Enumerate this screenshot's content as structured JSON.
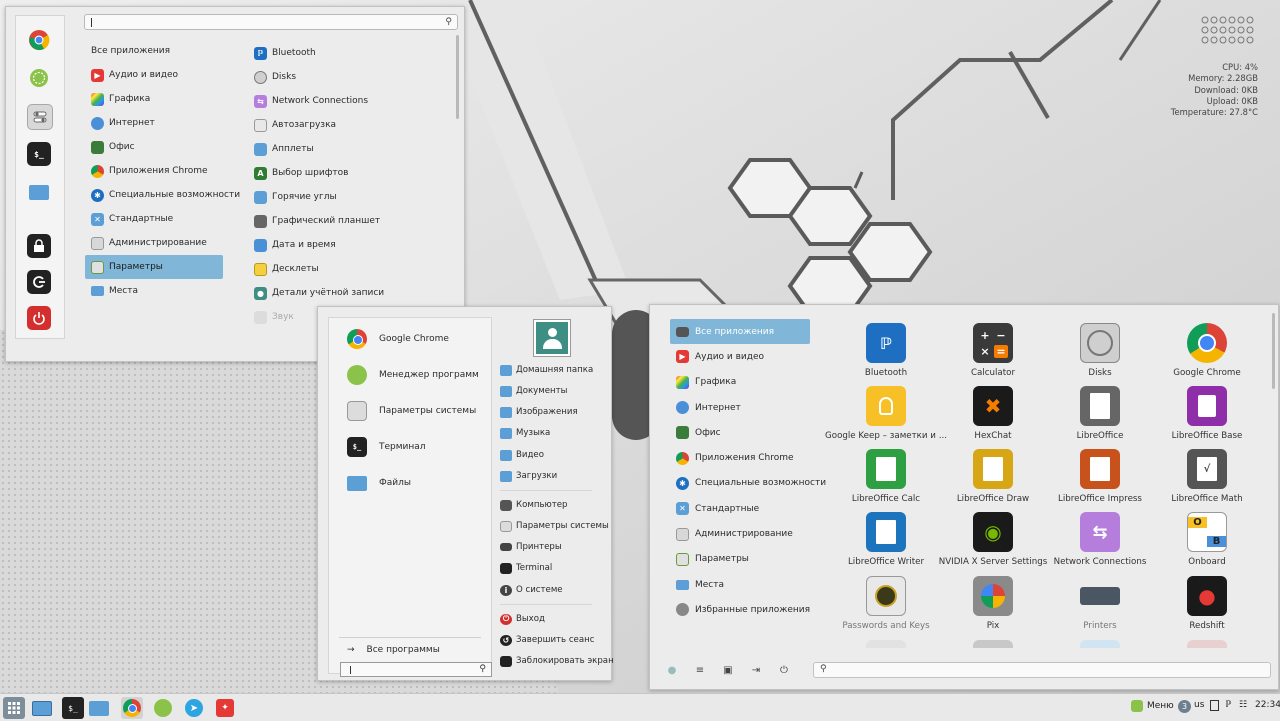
{
  "menu1": {
    "categories": [
      {
        "label": "Все приложения"
      },
      {
        "label": "Аудио и видео"
      },
      {
        "label": "Графика"
      },
      {
        "label": "Интернет"
      },
      {
        "label": "Офис"
      },
      {
        "label": "Приложения Chrome"
      },
      {
        "label": "Специальные возможности"
      },
      {
        "label": "Стандартные"
      },
      {
        "label": "Администрирование"
      },
      {
        "label": "Параметры"
      },
      {
        "label": "Места"
      }
    ],
    "apps": [
      {
        "label": "Bluetooth"
      },
      {
        "label": "Disks"
      },
      {
        "label": "Network Connections"
      },
      {
        "label": "Автозагрузка"
      },
      {
        "label": "Апплеты"
      },
      {
        "label": "Выбор шрифтов"
      },
      {
        "label": "Горячие углы"
      },
      {
        "label": "Графический планшет"
      },
      {
        "label": "Дата и время"
      },
      {
        "label": "Десклеты"
      },
      {
        "label": "Детали учётной записи"
      },
      {
        "label": "Звук"
      }
    ],
    "search_value": ""
  },
  "menu2": {
    "favorites": [
      {
        "label": "Google Chrome"
      },
      {
        "label": "Менеджер программ"
      },
      {
        "label": "Параметры системы"
      },
      {
        "label": "Терминал"
      },
      {
        "label": "Файлы"
      }
    ],
    "all_programs": "Все программы",
    "places": [
      {
        "label": "Домашняя папка"
      },
      {
        "label": "Документы"
      },
      {
        "label": "Изображения"
      },
      {
        "label": "Музыка"
      },
      {
        "label": "Видео"
      },
      {
        "label": "Загрузки"
      }
    ],
    "system": [
      {
        "label": "Компьютер"
      },
      {
        "label": "Параметры системы"
      },
      {
        "label": "Принтеры"
      },
      {
        "label": "Terminal"
      },
      {
        "label": "О системе"
      }
    ],
    "session": [
      {
        "label": "Выход"
      },
      {
        "label": "Завершить сеанс"
      },
      {
        "label": "Заблокировать экран"
      }
    ]
  },
  "menu3": {
    "categories": [
      {
        "label": "Все приложения"
      },
      {
        "label": "Аудио и видео"
      },
      {
        "label": "Графика"
      },
      {
        "label": "Интернет"
      },
      {
        "label": "Офис"
      },
      {
        "label": "Приложения Chrome"
      },
      {
        "label": "Специальные возможности"
      },
      {
        "label": "Стандартные"
      },
      {
        "label": "Администрирование"
      },
      {
        "label": "Параметры"
      },
      {
        "label": "Места"
      },
      {
        "label": "Избранные приложения"
      }
    ],
    "apps": [
      {
        "label": "Bluetooth"
      },
      {
        "label": "Calculator"
      },
      {
        "label": "Disks"
      },
      {
        "label": "Google Chrome"
      },
      {
        "label": "Google Keep – заметки и ..."
      },
      {
        "label": "HexChat"
      },
      {
        "label": "LibreOffice"
      },
      {
        "label": "LibreOffice Base"
      },
      {
        "label": "LibreOffice Calc"
      },
      {
        "label": "LibreOffice Draw"
      },
      {
        "label": "LibreOffice Impress"
      },
      {
        "label": "LibreOffice Math"
      },
      {
        "label": "LibreOffice Writer"
      },
      {
        "label": "NVIDIA X Server Settings"
      },
      {
        "label": "Network Connections"
      },
      {
        "label": "Onboard"
      },
      {
        "label": "Passwords and Keys"
      },
      {
        "label": "Pix"
      },
      {
        "label": "Printers"
      },
      {
        "label": "Redshift"
      }
    ]
  },
  "conky": {
    "cpu": "CPU: 4%",
    "memory": "Memory: 2.28GB",
    "download": "Download: 0KB",
    "upload": "Upload: 0KB",
    "temperature": "Temperature: 27.8°C"
  },
  "panel": {
    "menu_label": "Меню",
    "workspace": "3",
    "keyboard_layout": "us",
    "clock": "22:34"
  },
  "colors": {
    "selection": "#80b6d7",
    "folder": "#5c9fd6",
    "chrome_red": "#db4437",
    "chrome_yellow": "#f4b400",
    "chrome_green": "#0f9d58",
    "mint_green": "#8bc34a"
  }
}
